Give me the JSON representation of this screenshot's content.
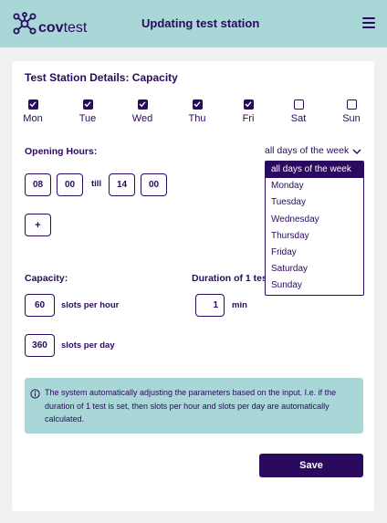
{
  "header": {
    "brand_bold": "cov",
    "brand_light": "test",
    "title": "Updating test station",
    "menu_icon": "hamburger-menu-icon"
  },
  "details": {
    "title": "Test Station Details: Capacity",
    "days": [
      {
        "label": "Mon",
        "checked": true
      },
      {
        "label": "Tue",
        "checked": true
      },
      {
        "label": "Wed",
        "checked": true
      },
      {
        "label": "Thu",
        "checked": true
      },
      {
        "label": "Fri",
        "checked": true
      },
      {
        "label": "Sat",
        "checked": false
      },
      {
        "label": "Sun",
        "checked": false
      }
    ],
    "opening_hours_label": "Opening Hours:",
    "day_filter": {
      "selected": "all days of the week",
      "options": [
        "all days of the week",
        "Monday",
        "Tuesday",
        "Wednesday",
        "Thursday",
        "Friday",
        "Saturday",
        "Sunday"
      ]
    },
    "hours": {
      "from_h": "08",
      "from_m": "00",
      "till_label": "till",
      "to_h": "14",
      "to_m": "00"
    },
    "add_label": "+",
    "capacity_label": "Capacity:",
    "duration_label": "Duration of 1 test:",
    "slots_hour_value": "60",
    "slots_hour_label": "slots per hour",
    "duration_value": "1",
    "duration_unit": "min",
    "slots_day_value": "360",
    "slots_day_label": "slots per day",
    "info_text": "The system automatically adjusting the parameters based on the input. I.e. if the duration of 1 test is set, then slots per hour and slots per day are automatically calculated.",
    "save_label": "Save"
  },
  "colors": {
    "primary": "#2a0a5e",
    "header_bg": "#a9d6d6",
    "page_bg": "#eef0f1"
  }
}
